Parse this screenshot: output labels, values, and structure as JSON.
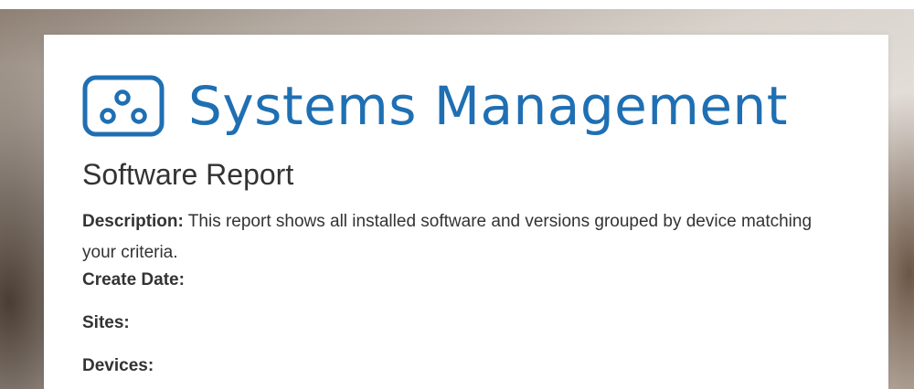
{
  "brand": {
    "name": "Systems Management",
    "color": "#1f6fb3",
    "icon": "systems-management-logo-icon"
  },
  "report": {
    "title": "Software Report",
    "description_label": "Description:",
    "description_text": " This report shows all installed software and versions grouped by device matching your criteria.",
    "create_date_label": "Create Date:",
    "sites_label": "Sites:",
    "devices_label": "Devices:"
  }
}
